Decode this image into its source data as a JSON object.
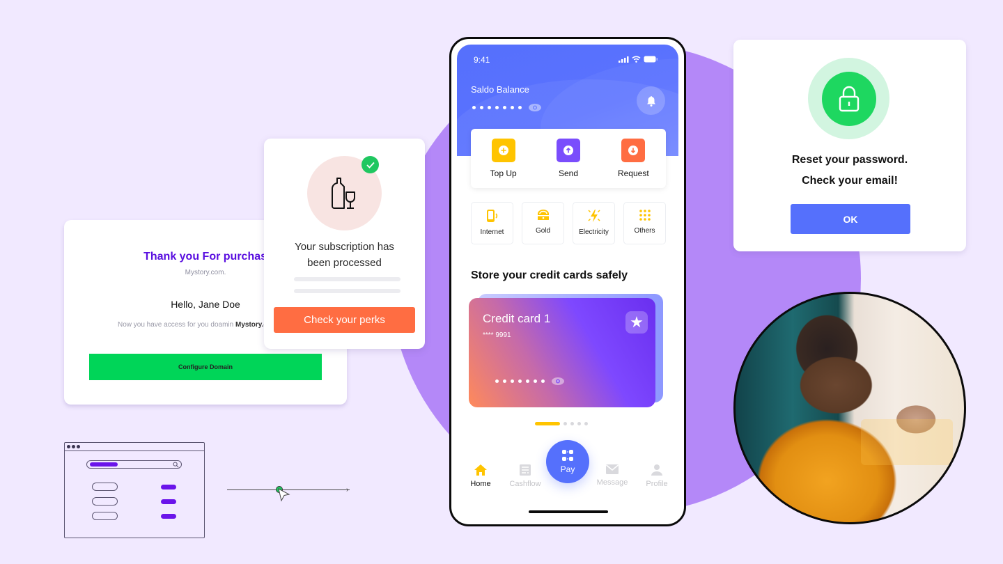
{
  "colors": {
    "background": "#f1e9ff",
    "accent_purple": "#b488f8",
    "brand_blue": "#5570fc",
    "green": "#1ed760",
    "orange": "#ff6d42",
    "yellow": "#ffc400"
  },
  "thanks_card": {
    "title": "Thank you For purchase",
    "subtitle": "Mystory.com.",
    "greeting": "Hello, Jane Doe",
    "access_text": "Now you have access for you doamin ",
    "access_domain": "Mystory.com",
    "button_label": "Configure Domain"
  },
  "subscription_card": {
    "icon": "bottle-glass-icon",
    "status_icon": "check-icon",
    "message_line1": "Your subscription has",
    "message_line2": "been processed",
    "button_label": "Check your perks"
  },
  "wireframe": {
    "icon": "browser-wireframe"
  },
  "phone": {
    "status_bar": {
      "time": "9:41"
    },
    "balance": {
      "label": "Saldo Balance",
      "masked": "•••••••"
    },
    "actions": [
      {
        "label": "Top Up",
        "icon": "plus-circle-icon",
        "color": "#ffc400"
      },
      {
        "label": "Send",
        "icon": "arrow-up-circle-icon",
        "color": "#7a4dfc"
      },
      {
        "label": "Request",
        "icon": "arrow-down-circle-icon",
        "color": "#ff6d42"
      }
    ],
    "services": [
      {
        "label": "Internet",
        "icon": "phone-signal-icon"
      },
      {
        "label": "Gold",
        "icon": "gold-icon"
      },
      {
        "label": "Electricity",
        "icon": "lightning-icon"
      },
      {
        "label": "Others",
        "icon": "grid-dots-icon"
      }
    ],
    "cards_title": "Store your credit cards safely",
    "credit_card": {
      "name": "Credit card 1",
      "number": "**** 9991",
      "masked": "•••••••"
    },
    "pager": {
      "current": 1,
      "total": 5
    },
    "nav": [
      {
        "label": "Home",
        "icon": "home-icon",
        "active": true
      },
      {
        "label": "Cashflow",
        "icon": "receipt-icon",
        "active": false
      },
      {
        "label": "Message",
        "icon": "mail-icon",
        "active": false
      },
      {
        "label": "Profile",
        "icon": "user-icon",
        "active": false
      }
    ],
    "pay_label": "Pay"
  },
  "reset_card": {
    "line1": "Reset your password.",
    "line2": "Check your email!",
    "button_label": "OK"
  }
}
